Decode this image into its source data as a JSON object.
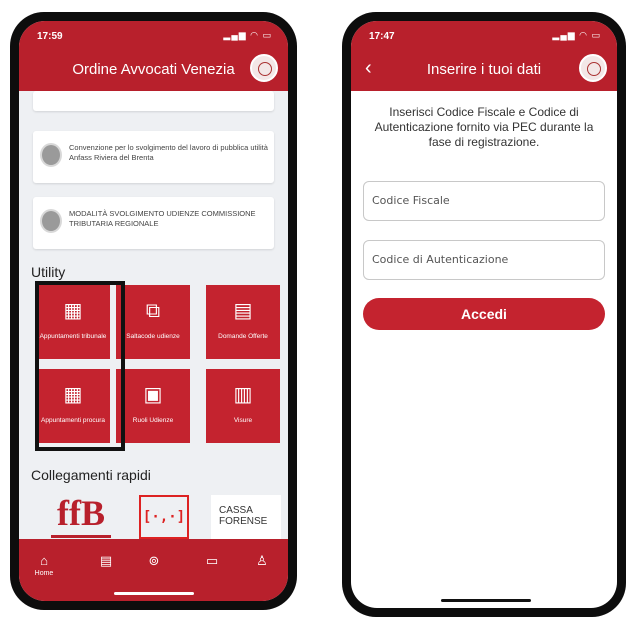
{
  "left": {
    "status": {
      "time": "17:59",
      "icons": "signal wifi battery"
    },
    "header": {
      "title": "Ordine Avvocati Venezia",
      "logo_icon": "seal-icon"
    },
    "cards": [
      {
        "text": "Convenzione per lo svolgimento del lavoro di pubblica utilità Anfass Riviera del Brenta"
      },
      {
        "text": "MODALITÀ SVOLGIMENTO UDIENZE COMMISSIONE TRIBUTARIA REGIONALE"
      }
    ],
    "utility": {
      "title": "Utility",
      "tiles": [
        {
          "label": "Appuntamenti tribunale",
          "icon": "calendar-icon"
        },
        {
          "label": "Saltacode udienze",
          "icon": "queue-icon"
        },
        {
          "label": "Domande Offerte",
          "icon": "chat-icon"
        },
        {
          "label": "Appuntamenti procura",
          "icon": "calendar-icon"
        },
        {
          "label": "Ruoli Udienze",
          "icon": "briefcase-icon"
        },
        {
          "label": "Visure",
          "icon": "document-icon"
        }
      ]
    },
    "links": {
      "title": "Collegamenti rapidi",
      "items": [
        {
          "text": "ffB",
          "icon": "ffb-logo"
        },
        {
          "text": "[·,·]",
          "icon": "pct-logo"
        },
        {
          "text": "CASSA FORENSE",
          "icon": "cassa-forense-logo"
        }
      ]
    },
    "tabbar": {
      "home_label": "Home",
      "icons": [
        "home-icon",
        "news-icon",
        "services-icon",
        "card-icon",
        "profile-icon"
      ]
    }
  },
  "right": {
    "status": {
      "time": "17:47",
      "icons": "signal wifi battery"
    },
    "header": {
      "title": "Inserire i tuoi dati",
      "back_icon": "chevron-left-icon"
    },
    "info": "Inserisci Codice Fiscale e Codice di Autenticazione fornito via PEC durante la fase di registrazione.",
    "fields": {
      "codice_fiscale": "Codice Fiscale",
      "codice_autenticazione": "Codice di Autenticazione"
    },
    "button": "Accedi"
  },
  "colors": {
    "primary": "#b8202c",
    "tile": "#c4232f",
    "background": "#eef0f3"
  }
}
